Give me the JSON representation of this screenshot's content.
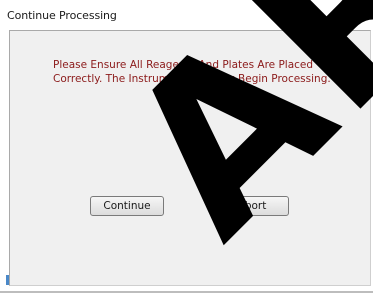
{
  "dialog": {
    "title": "Continue Processing",
    "message": "Please Ensure All Reagents And Plates Are Placed Correctly. The Instrument Will Now Begin Processing.",
    "buttons": {
      "continue_label": "Continue",
      "abort_label": "Abort"
    }
  },
  "watermark": {
    "text": "ARC",
    "color": "#000000"
  },
  "colors": {
    "message_text": "#8b1a1a",
    "panel_background": "#f0f0f0"
  }
}
